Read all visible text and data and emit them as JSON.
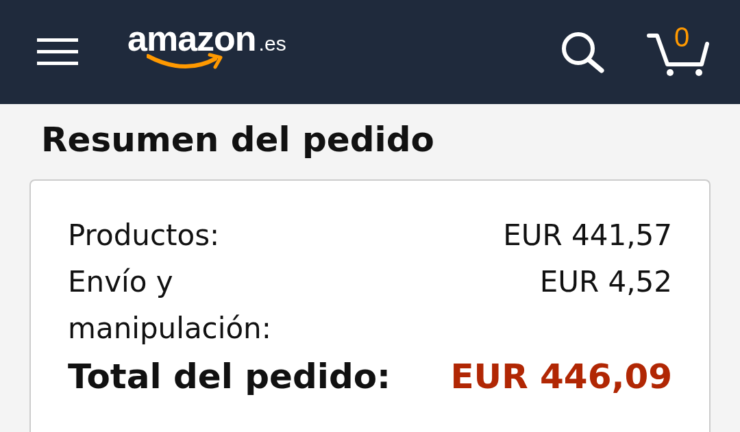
{
  "header": {
    "logo": {
      "name": "amazon",
      "suffix": ".es"
    },
    "cart_count": "0"
  },
  "title": "Resumen del pedido",
  "summary": [
    {
      "kind": "line",
      "label": "Productos:",
      "value": "EUR 441,57"
    },
    {
      "kind": "line",
      "label": "Envío y manipulación:",
      "value": "EUR 4,52"
    },
    {
      "kind": "total",
      "label": "Total del pedido:",
      "value": "EUR 446,09"
    }
  ]
}
